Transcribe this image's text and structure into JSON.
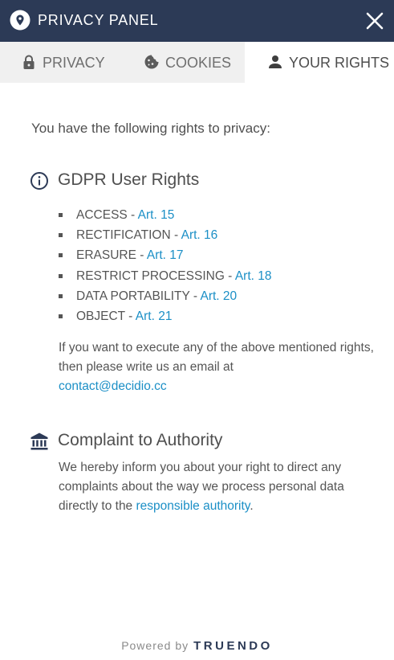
{
  "header": {
    "title": "PRIVACY PANEL"
  },
  "tabs": [
    {
      "label": "PRIVACY",
      "icon": "lock-icon"
    },
    {
      "label": "COOKIES",
      "icon": "cookie-icon"
    },
    {
      "label": "YOUR RIGHTS",
      "icon": "person-icon",
      "active": true
    }
  ],
  "intro": "You have the following rights to privacy:",
  "gdpr": {
    "title": "GDPR User Rights",
    "rights": [
      {
        "label": "ACCESS - ",
        "link": "Art. 15"
      },
      {
        "label": "RECTIFICATION - ",
        "link": "Art. 16"
      },
      {
        "label": "ERASURE - ",
        "link": "Art. 17"
      },
      {
        "label": "RESTRICT PROCESSING - ",
        "link": "Art. 18"
      },
      {
        "label": "DATA PORTABILITY - ",
        "link": "Art. 20"
      },
      {
        "label": "OBJECT - ",
        "link": "Art. 21"
      }
    ],
    "contact_text": "If you want to execute any of the above mentioned rights, then please write us an email at",
    "contact_email": "contact@decidio.cc"
  },
  "complaint": {
    "title": "Complaint to Authority",
    "text": "We hereby inform you about your right to direct any complaints about the way we process personal data directly to the",
    "link": "responsible authority",
    "end": "."
  },
  "footer": {
    "powered_by": "Powered by",
    "brand": "TRUENDO"
  },
  "colors": {
    "header_bg": "#2c3a56",
    "link": "#1b8fc6",
    "tab_inactive_bg": "#f0f0f0"
  }
}
